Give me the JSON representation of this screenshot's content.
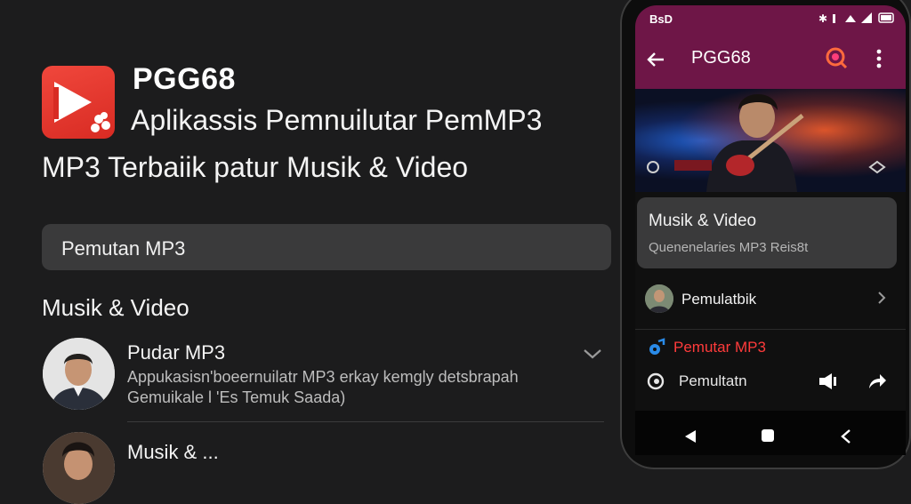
{
  "promo": {
    "app_name": "PGG68",
    "tagline": "Aplikassis Pemnuilutar PemMP3",
    "subtitle": "MP3 Terbaiik patur Musik & Video",
    "search_value": "Pemutan MP3",
    "section_heading": "Musik & Video",
    "list": [
      {
        "title": "Pudar MP3",
        "desc_line1": "Appukasisn'boeernuilatr MP3 erkay kemgly detsbrapah",
        "desc_line2": "Gemuikale l 'Es Temuk Saada)"
      },
      {
        "title": "Musik & ..."
      }
    ],
    "icon": "play-icon",
    "accent": "#e8352c"
  },
  "phone": {
    "status": {
      "time": "BsD"
    },
    "app_bar": {
      "title": "PGG68"
    },
    "card": {
      "title": "Musik & Video",
      "subtitle": "Quenenelaries MP3 Reis8t"
    },
    "rows": [
      {
        "label": "Pemulatbik"
      },
      {
        "label": "Pemutar MP3",
        "color": "#ff3b3b"
      },
      {
        "label": "Pemultatn"
      }
    ],
    "theme_color": "#6e1647"
  }
}
